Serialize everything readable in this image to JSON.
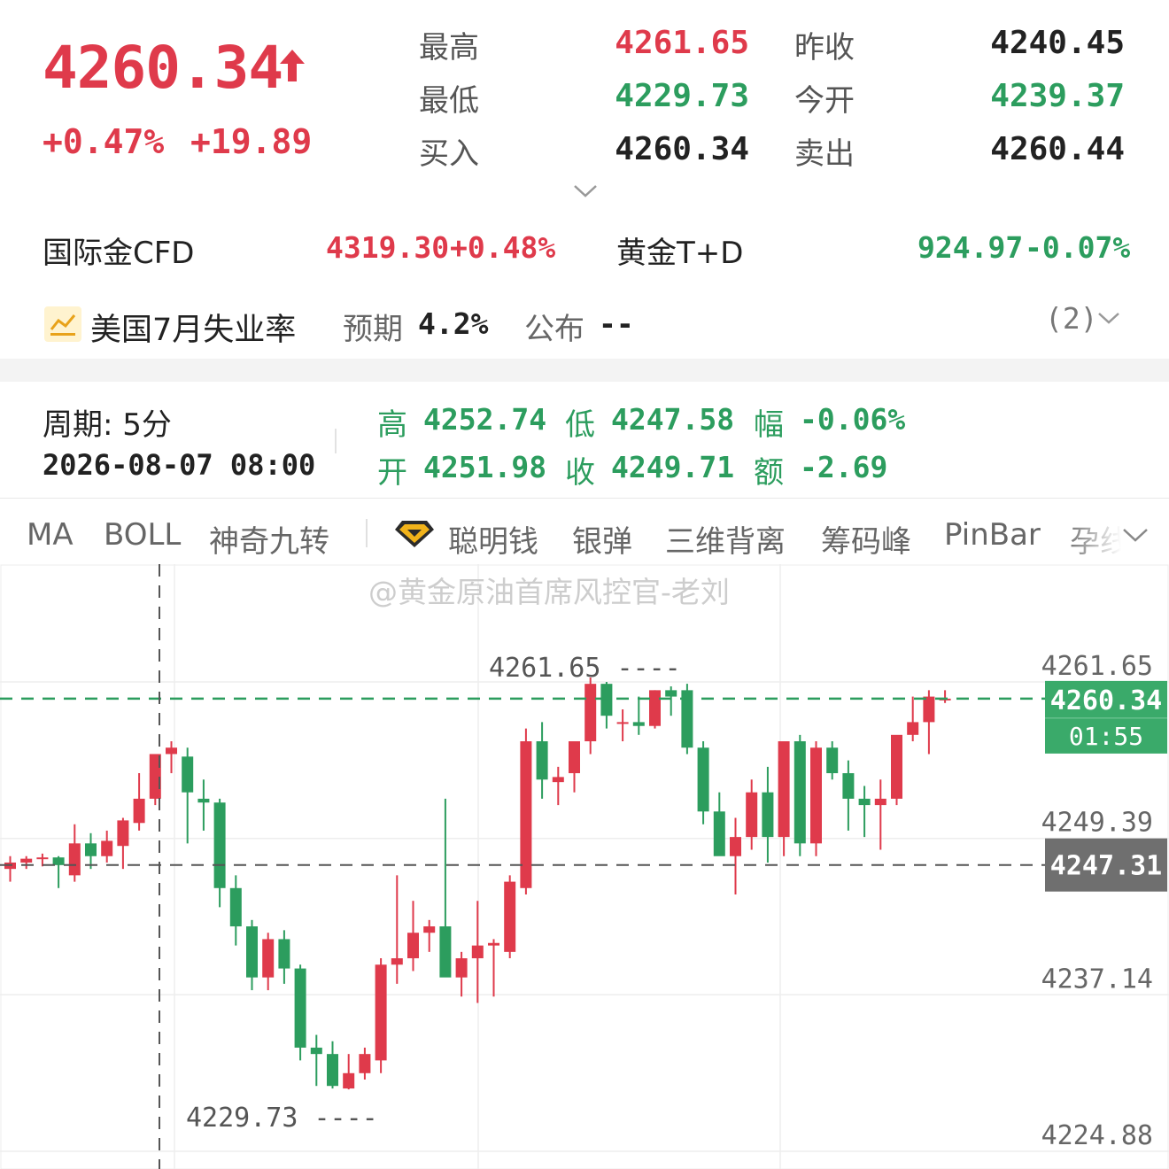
{
  "quote": {
    "price": "4260.34",
    "change_pct": "+0.47%",
    "change_abs": "+19.89",
    "rows": [
      {
        "l1": "最高",
        "v1": "4261.65",
        "c1": "red",
        "l2": "昨收",
        "v2": "4240.45",
        "c2": "dark"
      },
      {
        "l1": "最低",
        "v1": "4229.73",
        "c1": "green",
        "l2": "今开",
        "v2": "4239.37",
        "c2": "green"
      },
      {
        "l1": "买入",
        "v1": "4260.34",
        "c1": "dark",
        "l2": "卖出",
        "v2": "4260.44",
        "c2": "dark"
      }
    ]
  },
  "markets": [
    {
      "name": "国际金CFD",
      "price": "4319.30",
      "pct": "+0.48%",
      "color": "red"
    },
    {
      "name": "黄金T+D",
      "price": "924.97",
      "pct": "-0.07%",
      "color": "green"
    }
  ],
  "economic": {
    "title": "美国7月失业率",
    "expected_label": "预期",
    "expected_value": "4.2%",
    "published_label": "公布",
    "published_value": "--",
    "count": "(2)"
  },
  "period": {
    "label": "周期:  5分",
    "time": "2026-08-07 08:00",
    "high_k": "高",
    "high_v": "4252.74",
    "low_k": "低",
    "low_v": "4247.58",
    "amp_k": "幅",
    "amp_v": "-0.06%",
    "open_k": "开",
    "open_v": "4251.98",
    "close_k": "收",
    "close_v": "4249.71",
    "amt_k": "额",
    "amt_v": "-2.69"
  },
  "indicators": [
    "MA",
    "BOLL",
    "神奇九转",
    "聪明钱",
    "银弹",
    "三维背离",
    "筹码峰",
    "PinBar",
    "孕线"
  ],
  "watermark": "@黄金原油首席风控官-老刘",
  "colors": {
    "up": "#df3a4b",
    "down": "#2c9d5e",
    "text": "#222222",
    "muted": "#555555"
  },
  "chart_data": {
    "type": "candlestick",
    "y_ticks": [
      "4261.65",
      "4249.39",
      "4237.14",
      "4224.88"
    ],
    "ylim": [
      4224.88,
      4261.65
    ],
    "current_price": "4260.34",
    "countdown": "01:55",
    "crosshair_price": "4247.31",
    "max_label": "4261.65",
    "min_label": "4229.73",
    "grid": true,
    "candles": [
      [
        4247.0,
        4248.0,
        4246.0,
        4247.5
      ],
      [
        4247.5,
        4248.0,
        4247.0,
        4247.8
      ],
      [
        4247.8,
        4248.2,
        4247.2,
        4247.9
      ],
      [
        4247.9,
        4248.0,
        4245.5,
        4247.3
      ],
      [
        4246.5,
        4250.5,
        4246.0,
        4249.0
      ],
      [
        4249.0,
        4249.8,
        4247.0,
        4248.0
      ],
      [
        4248.0,
        4250.0,
        4247.5,
        4249.2
      ],
      [
        4248.8,
        4251.0,
        4247.0,
        4250.8
      ],
      [
        4250.6,
        4254.5,
        4250.0,
        4252.5
      ],
      [
        4252.5,
        4255.0,
        4252.0,
        4256.0
      ],
      [
        4256.0,
        4257.0,
        4254.5,
        4256.5
      ],
      [
        4255.8,
        4256.5,
        4249.0,
        4253.0
      ],
      [
        4252.5,
        4254.0,
        4250.0,
        4252.2
      ],
      [
        4252.2,
        4252.5,
        4244.0,
        4245.5
      ],
      [
        4245.5,
        4246.5,
        4241.0,
        4242.5
      ],
      [
        4242.5,
        4243.0,
        4237.5,
        4238.5
      ],
      [
        4238.5,
        4242.0,
        4237.5,
        4241.5
      ],
      [
        4241.5,
        4242.2,
        4238.0,
        4239.2
      ],
      [
        4239.2,
        4239.5,
        4232.0,
        4233.0
      ],
      [
        4233.0,
        4234.0,
        4230.0,
        4232.5
      ],
      [
        4232.5,
        4233.5,
        4229.8,
        4230.0
      ],
      [
        4229.8,
        4232.5,
        4229.73,
        4231.0
      ],
      [
        4231.0,
        4233.0,
        4230.5,
        4232.5
      ],
      [
        4232.0,
        4240.0,
        4231.0,
        4239.5
      ],
      [
        4239.5,
        4246.5,
        4238.0,
        4240.0
      ],
      [
        4240.0,
        4244.5,
        4239.0,
        4242.0
      ],
      [
        4242.0,
        4243.0,
        4240.5,
        4242.5
      ],
      [
        4242.5,
        4252.5,
        4239.0,
        4238.5
      ],
      [
        4238.5,
        4240.5,
        4237.0,
        4240.0
      ],
      [
        4240.0,
        4244.5,
        4236.5,
        4241.0
      ],
      [
        4241.0,
        4241.5,
        4237.0,
        4241.2
      ],
      [
        4240.5,
        4246.5,
        4240.0,
        4246.0
      ],
      [
        4245.5,
        4258.0,
        4245.0,
        4257.0
      ],
      [
        4257.0,
        4258.5,
        4252.5,
        4254.0
      ],
      [
        4253.8,
        4255.0,
        4252.0,
        4254.2
      ],
      [
        4254.5,
        4256.5,
        4253.0,
        4257.0
      ],
      [
        4257.0,
        4262.0,
        4256.0,
        4261.5
      ],
      [
        4261.5,
        4261.65,
        4258.0,
        4259.0
      ],
      [
        4258.5,
        4259.5,
        4257.0,
        4258.5
      ],
      [
        4258.5,
        4260.5,
        4257.5,
        4258.2
      ],
      [
        4258.2,
        4261.0,
        4258.0,
        4261.0
      ],
      [
        4261.0,
        4261.3,
        4259.0,
        4260.5
      ],
      [
        4261.0,
        4261.5,
        4256.0,
        4256.5
      ],
      [
        4256.5,
        4257.0,
        4250.5,
        4251.5
      ],
      [
        4251.5,
        4253.0,
        4249.0,
        4248.0
      ],
      [
        4248.0,
        4251.0,
        4245.0,
        4249.5
      ],
      [
        4249.5,
        4254.0,
        4248.5,
        4253.0
      ],
      [
        4253.0,
        4255.0,
        4247.5,
        4249.5
      ],
      [
        4249.5,
        4254.5,
        4248.0,
        4257.0
      ],
      [
        4257.0,
        4257.5,
        4248.0,
        4249.0
      ],
      [
        4249.0,
        4257.0,
        4248.0,
        4256.5
      ],
      [
        4256.5,
        4257.0,
        4254.0,
        4254.5
      ],
      [
        4254.5,
        4255.5,
        4250.0,
        4252.5
      ],
      [
        4252.5,
        4253.5,
        4249.5,
        4252.0
      ],
      [
        4252.0,
        4254.0,
        4248.5,
        4252.5
      ],
      [
        4252.5,
        4256.0,
        4252.0,
        4257.5
      ],
      [
        4257.5,
        4260.5,
        4257.0,
        4258.5
      ],
      [
        4258.5,
        4261.0,
        4256.0,
        4260.5
      ],
      [
        4260.3,
        4261.0,
        4260.0,
        4260.34
      ]
    ]
  }
}
